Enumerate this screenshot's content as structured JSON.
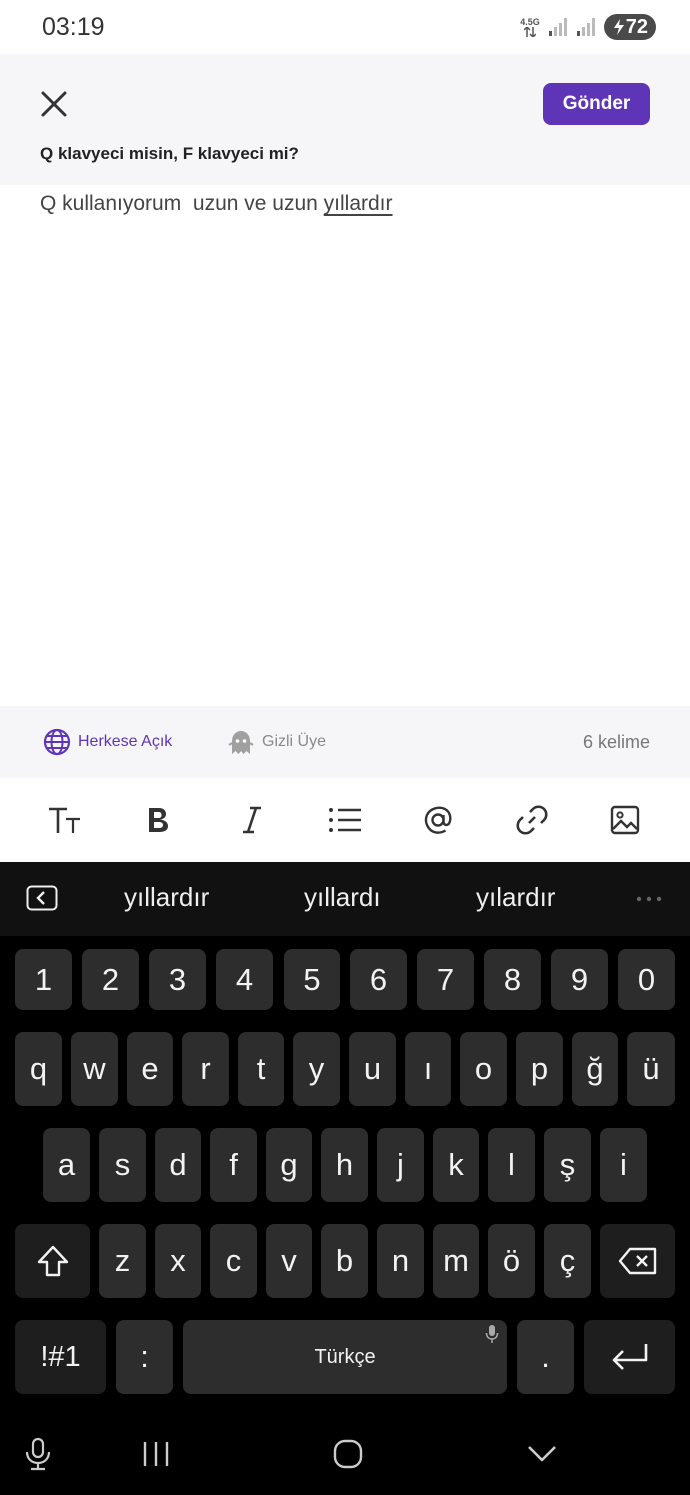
{
  "status_bar": {
    "time": "03:19",
    "network": "4.5G",
    "battery": "72"
  },
  "header": {
    "send_label": "Gönder",
    "question": "Q klavyeci misin, F klavyeci mi?"
  },
  "editor": {
    "typed_text": "Q kullanıyorum  uzun ve uzun ",
    "current_word": "yıllardır"
  },
  "options": {
    "public_label": "Herkese Açık",
    "anonymous_label": "Gizli Üye",
    "word_count": "6 kelime"
  },
  "keyboard": {
    "suggestions": [
      "yıllardır",
      "yıllardı",
      "yılardır"
    ],
    "number_row": [
      "1",
      "2",
      "3",
      "4",
      "5",
      "6",
      "7",
      "8",
      "9",
      "0"
    ],
    "row1": [
      "q",
      "w",
      "e",
      "r",
      "t",
      "y",
      "u",
      "ı",
      "o",
      "p",
      "ğ",
      "ü"
    ],
    "row2": [
      "a",
      "s",
      "d",
      "f",
      "g",
      "h",
      "j",
      "k",
      "l",
      "ş",
      "i"
    ],
    "row3": [
      "z",
      "x",
      "c",
      "v",
      "b",
      "n",
      "m",
      "ö",
      "ç"
    ],
    "symbols_label": "!#1",
    "colon_label": ":",
    "space_label": "Türkçe",
    "period_label": "."
  },
  "colors": {
    "accent": "#5f35b8",
    "key_bg": "#2d2d2d",
    "keyboard_bg": "#000000"
  }
}
